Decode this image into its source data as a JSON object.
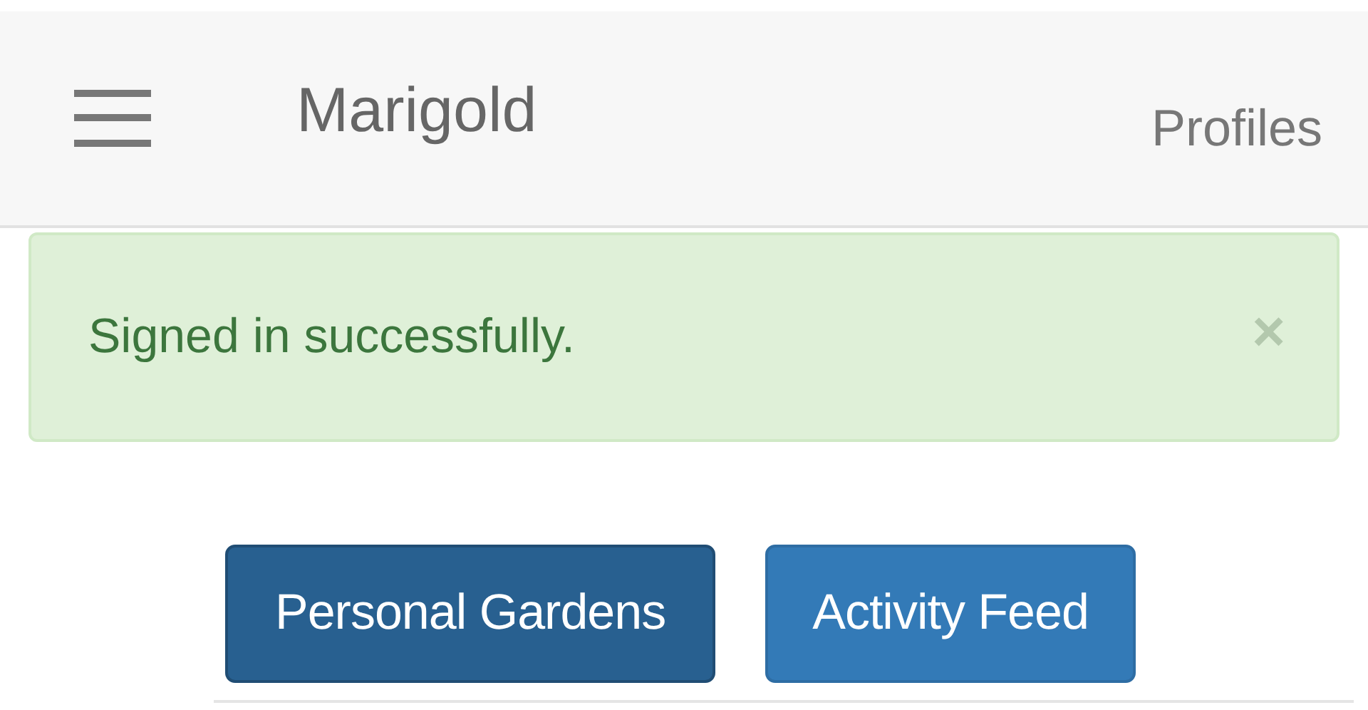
{
  "navbar": {
    "brand": "Marigold",
    "link": "Profiles"
  },
  "alert": {
    "message": "Signed in successfully.",
    "close": "×"
  },
  "tabs": [
    {
      "label": "Personal Gardens",
      "selected": true
    },
    {
      "label": "Activity Feed",
      "selected": false
    }
  ]
}
